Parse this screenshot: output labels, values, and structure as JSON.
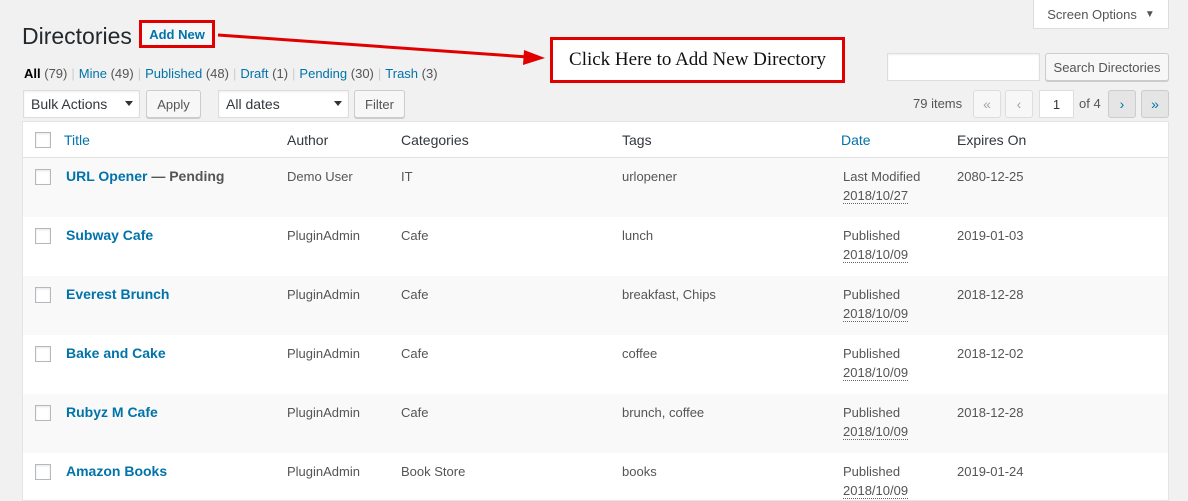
{
  "screen_options": {
    "label": "Screen Options",
    "arrow": "▼"
  },
  "header": {
    "title": "Directories",
    "add_new": "Add New"
  },
  "annotation": {
    "text": "Click Here to Add New Directory",
    "color": "#e00000"
  },
  "views": [
    {
      "label": "All",
      "count": "(79)"
    },
    {
      "label": "Mine",
      "count": "(49)"
    },
    {
      "label": "Published",
      "count": "(48)"
    },
    {
      "label": "Draft",
      "count": "(1)"
    },
    {
      "label": "Pending",
      "count": "(30)"
    },
    {
      "label": "Trash",
      "count": "(3)"
    }
  ],
  "search": {
    "placeholder": "",
    "button": "Search Directories"
  },
  "tablenav": {
    "bulk_actions": "Bulk Actions",
    "apply": "Apply",
    "dates": "All dates",
    "filter": "Filter",
    "items": "79 items",
    "first": "«",
    "prev": "‹",
    "current_page": "1",
    "of_pages": "of 4",
    "next": "›",
    "last": "»"
  },
  "table": {
    "columns": {
      "title": "Title",
      "author": "Author",
      "categories": "Categories",
      "tags": "Tags",
      "date": "Date",
      "expires": "Expires On"
    },
    "rows": [
      {
        "title": "URL Opener",
        "state": " — Pending",
        "author": "Demo User",
        "categories": "IT",
        "tags": "urlopener",
        "date_status": "Last Modified",
        "date": "2018/10/27",
        "expires": "2080-12-25"
      },
      {
        "title": "Subway Cafe",
        "state": "",
        "author": "PluginAdmin",
        "categories": "Cafe",
        "tags": "lunch",
        "date_status": "Published",
        "date": "2018/10/09",
        "expires": "2019-01-03"
      },
      {
        "title": "Everest Brunch",
        "state": "",
        "author": "PluginAdmin",
        "categories": "Cafe",
        "tags": "breakfast, Chips",
        "date_status": "Published",
        "date": "2018/10/09",
        "expires": "2018-12-28"
      },
      {
        "title": "Bake and Cake",
        "state": "",
        "author": "PluginAdmin",
        "categories": "Cafe",
        "tags": "coffee",
        "date_status": "Published",
        "date": "2018/10/09",
        "expires": "2018-12-02"
      },
      {
        "title": "Rubyz M Cafe",
        "state": "",
        "author": "PluginAdmin",
        "categories": "Cafe",
        "tags": "brunch, coffee",
        "date_status": "Published",
        "date": "2018/10/09",
        "expires": "2018-12-28"
      },
      {
        "title": "Amazon Books",
        "state": "",
        "author": "PluginAdmin",
        "categories": "Book Store",
        "tags": "books",
        "date_status": "Published",
        "date": "2018/10/09",
        "expires": "2019-01-24"
      }
    ]
  }
}
